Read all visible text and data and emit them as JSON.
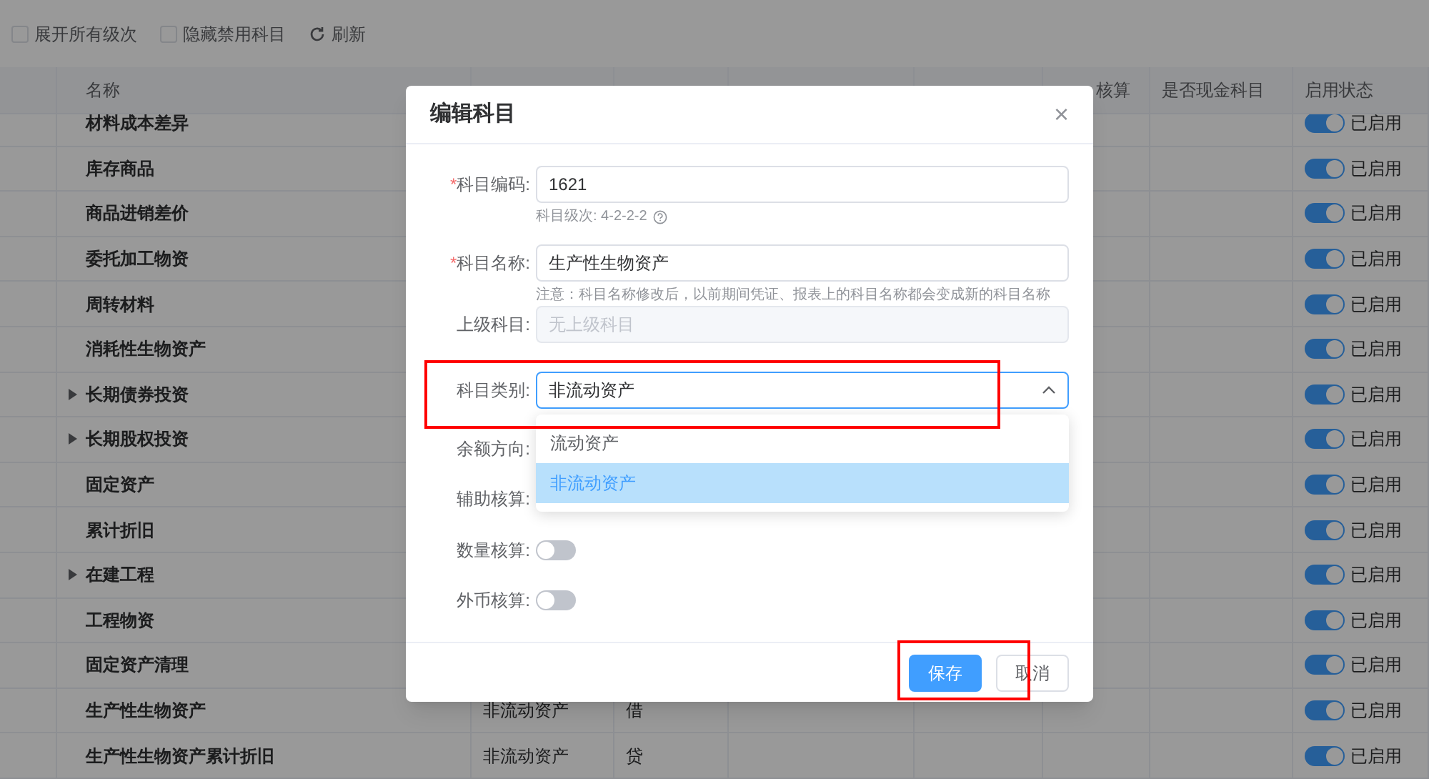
{
  "toolbar": {
    "options": [
      {
        "label": "展开所有级次",
        "checked": false
      },
      {
        "label": "隐藏禁用科目",
        "checked": false
      }
    ],
    "refresh": "刷新"
  },
  "table": {
    "columns": [
      {},
      {
        "label": "名称"
      },
      {},
      {},
      {},
      {},
      {
        "label": "核算"
      },
      {
        "label": "是否现金科目"
      },
      {
        "label": "启用状态"
      }
    ],
    "rows": [
      {
        "name": "材料成本差异",
        "expandable": false,
        "enabled": true,
        "status": "已启用"
      },
      {
        "name": "库存商品",
        "expandable": false,
        "enabled": true,
        "status": "已启用"
      },
      {
        "name": "商品进销差价",
        "expandable": false,
        "enabled": true,
        "status": "已启用"
      },
      {
        "name": "委托加工物资",
        "expandable": false,
        "enabled": true,
        "status": "已启用"
      },
      {
        "name": "周转材料",
        "expandable": false,
        "enabled": true,
        "status": "已启用"
      },
      {
        "name": "消耗性生物资产",
        "expandable": false,
        "enabled": true,
        "status": "已启用"
      },
      {
        "name": "长期债券投资",
        "expandable": true,
        "enabled": true,
        "status": "已启用"
      },
      {
        "name": "长期股权投资",
        "expandable": true,
        "enabled": true,
        "status": "已启用"
      },
      {
        "name": "固定资产",
        "expandable": false,
        "enabled": true,
        "status": "已启用"
      },
      {
        "name": "累计折旧",
        "expandable": false,
        "enabled": true,
        "status": "已启用"
      },
      {
        "name": "在建工程",
        "expandable": true,
        "enabled": true,
        "status": "已启用"
      },
      {
        "name": "工程物资",
        "expandable": false,
        "enabled": true,
        "status": "已启用"
      },
      {
        "name": "固定资产清理",
        "expandable": false,
        "enabled": true,
        "status": "已启用"
      },
      {
        "name": "生产性生物资产",
        "expandable": false,
        "category": "非流动资产",
        "balance": "借",
        "enabled": true,
        "status": "已启用"
      },
      {
        "name": "生产性生物资产累计折旧",
        "expandable": false,
        "category": "非流动资产",
        "balance": "贷",
        "enabled": true,
        "status": "已启用"
      }
    ]
  },
  "dialog": {
    "title": "编辑科目",
    "close": "×",
    "fields": [
      {
        "kind": "input",
        "label": "科目编码:",
        "required": "*",
        "value": "1621",
        "hint": "科目级次: 4-2-2-2",
        "hint_icon": true
      },
      {
        "kind": "input",
        "label": "科目名称:",
        "required": "*",
        "value": "生产性生物资产",
        "hint": "注意：科目名称修改后，以前期间凭证、报表上的科目名称都会变成新的科目名称"
      },
      {
        "kind": "input",
        "label": "上级科目:",
        "disabled": true,
        "placeholder": "无上级科目"
      },
      {
        "kind": "select",
        "label": "科目类别:",
        "value": "非流动资产",
        "expanded": true,
        "highlighted": true,
        "options": [
          {
            "label": "流动资产",
            "selected": false
          },
          {
            "label": "非流动资产",
            "selected": true
          }
        ]
      },
      {
        "kind": "covered",
        "label": "余额方向:"
      },
      {
        "kind": "covered",
        "label": "辅助核算:"
      },
      {
        "kind": "switch",
        "label": "数量核算:",
        "on": false
      },
      {
        "kind": "switch",
        "label": "外币核算:",
        "on": false
      }
    ],
    "buttons": [
      {
        "label": "保存",
        "primary": true,
        "highlighted": true
      },
      {
        "label": "取消",
        "primary": false
      }
    ]
  }
}
